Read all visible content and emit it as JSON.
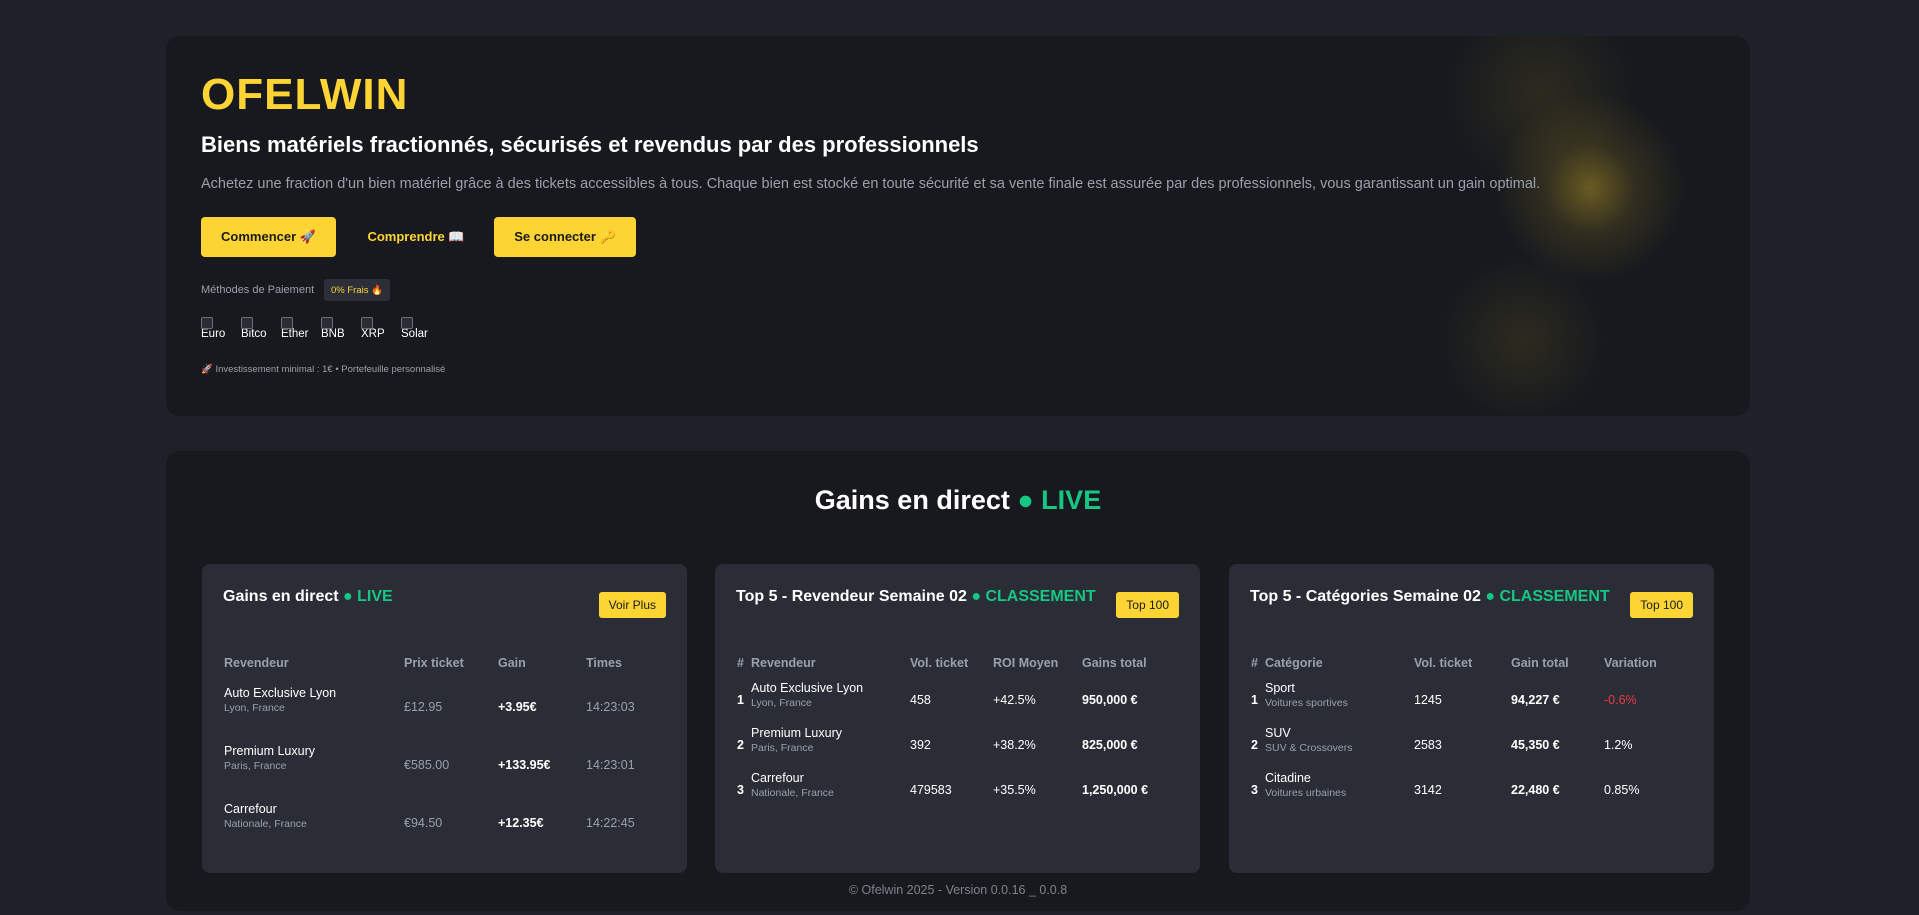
{
  "hero": {
    "brand": "OFELWIN",
    "tagline": "Biens matériels fractionnés, sécurisés et revendus par des professionnels",
    "description": "Achetez une fraction d'un bien matériel grâce à des tickets accessibles à tous. Chaque bien est stocké en toute sécurité et sa vente finale est assurée par des professionnels, vous garantissant un gain optimal.",
    "buttons": {
      "start": "Commencer 🚀",
      "understand": "Comprendre 📖",
      "login": "Se connecter 🔑"
    },
    "payment_label": "Méthodes de Paiement",
    "payment_badge": "0% Frais 🔥",
    "payment_methods": [
      "Euro",
      "Bitco",
      "Ether",
      "BNB",
      "XRP",
      "Solar"
    ],
    "invest_note": "🚀 Investissement minimal : 1€ • Portefeuille personnalisé"
  },
  "live": {
    "title": "Gains en direct",
    "title_live": "● LIVE"
  },
  "card1": {
    "title": "Gains en direct",
    "title_tag": "● LIVE",
    "button": "Voir Plus",
    "headers": [
      "Revendeur",
      "Prix ticket",
      "Gain",
      "Times"
    ],
    "rows": [
      {
        "name": "Auto Exclusive Lyon",
        "loc": "Lyon, France",
        "price": "£12.95",
        "gain": "+3.95€",
        "time": "14:23:03"
      },
      {
        "name": "Premium Luxury",
        "loc": "Paris, France",
        "price": "€585.00",
        "gain": "+133.95€",
        "time": "14:23:01"
      },
      {
        "name": "Carrefour",
        "loc": "Nationale, France",
        "price": "€94.50",
        "gain": "+12.35€",
        "time": "14:22:45"
      }
    ]
  },
  "card2": {
    "title": "Top 5 - Revendeur Semaine 02",
    "title_tag": "● CLASSEMENT",
    "button": "Top 100",
    "headers": [
      "#",
      "Revendeur",
      "Vol. ticket",
      "ROI Moyen",
      "Gains total"
    ],
    "rows": [
      {
        "rank": "1",
        "name": "Auto Exclusive Lyon",
        "loc": "Lyon, France",
        "vol": "458",
        "roi": "+42.5%",
        "total": "950,000 €"
      },
      {
        "rank": "2",
        "name": "Premium Luxury",
        "loc": "Paris, France",
        "vol": "392",
        "roi": "+38.2%",
        "total": "825,000 €"
      },
      {
        "rank": "3",
        "name": "Carrefour",
        "loc": "Nationale, France",
        "vol": "479583",
        "roi": "+35.5%",
        "total": "1,250,000 €"
      }
    ]
  },
  "card3": {
    "title": "Top 5 - Catégories Semaine 02",
    "title_tag": "● CLASSEMENT",
    "button": "Top 100",
    "headers": [
      "#",
      "Catégorie",
      "Vol. ticket",
      "Gain total",
      "Variation"
    ],
    "rows": [
      {
        "rank": "1",
        "name": "Sport",
        "sub": "Voitures sportives",
        "vol": "1245",
        "total": "94,227 €",
        "var": "-0.6%"
      },
      {
        "rank": "2",
        "name": "SUV",
        "sub": "SUV & Crossovers",
        "vol": "2583",
        "total": "45,350 €",
        "var": "1.2%"
      },
      {
        "rank": "3",
        "name": "Citadine",
        "sub": "Voitures urbaines",
        "vol": "3142",
        "total": "22,480 €",
        "var": "0.85%"
      }
    ]
  },
  "footer": "© Ofelwin 2025 - Version 0.0.16 _ 0.0.8",
  "colors": {
    "accent": "#fcd535",
    "positive": "#16c784",
    "negative": "#ea3943",
    "card": "#2a2d36"
  }
}
